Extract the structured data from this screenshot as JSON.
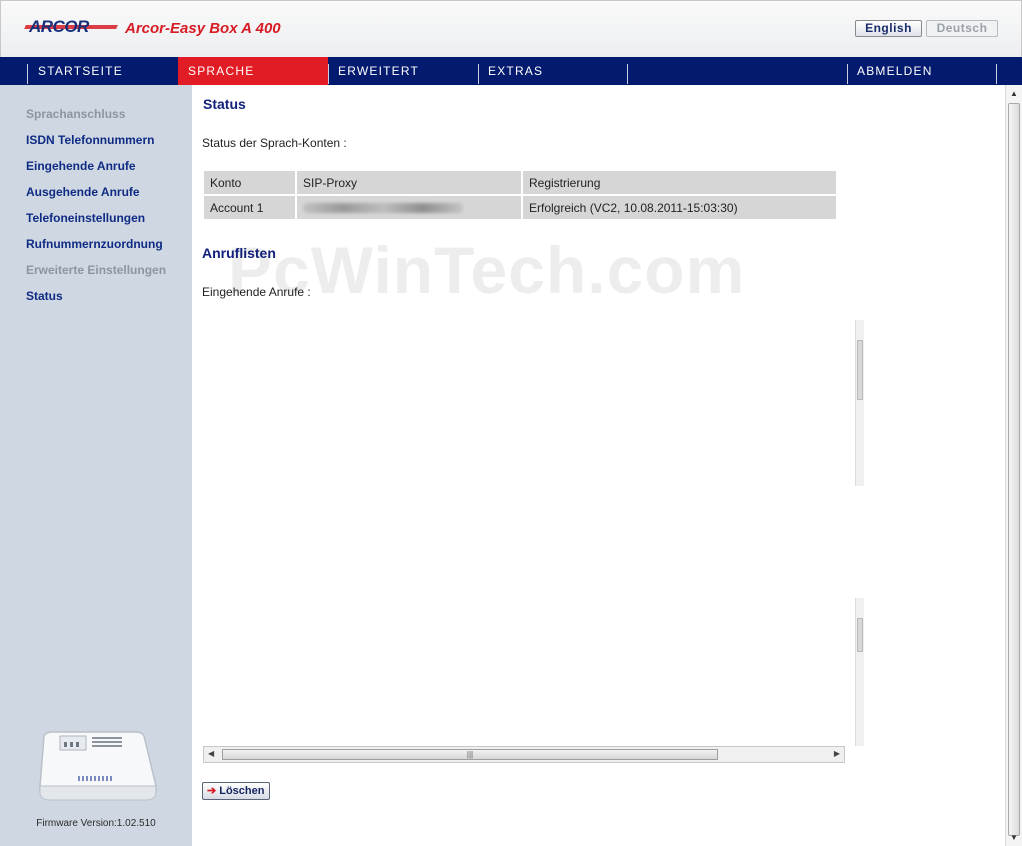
{
  "header": {
    "logo": "ARCOR",
    "product": "Arcor-Easy Box A 400",
    "lang_english": "English",
    "lang_deutsch": "Deutsch"
  },
  "nav": {
    "items": [
      "STARTSEITE",
      "SPRACHE",
      "ERWEITERT",
      "EXTRAS",
      "ABMELDEN"
    ],
    "active": "SPRACHE"
  },
  "sidebar": {
    "items": [
      {
        "label": "Sprachanschluss",
        "style": "muted"
      },
      {
        "label": "ISDN Telefonnummern",
        "style": "link"
      },
      {
        "label": "Eingehende Anrufe",
        "style": "link"
      },
      {
        "label": "Ausgehende Anrufe",
        "style": "link"
      },
      {
        "label": "Telefoneinstellungen",
        "style": "link"
      },
      {
        "label": "Rufnummernzuordnung",
        "style": "link"
      },
      {
        "label": "Erweiterte Einstellungen",
        "style": "muted"
      },
      {
        "label": "Status",
        "style": "link"
      }
    ],
    "firmware": "Firmware Version:1.02.510"
  },
  "main": {
    "status_title": "Status",
    "status_label": "Status der Sprach-Konten :",
    "table": {
      "headers": [
        "Konto",
        "SIP-Proxy",
        "Registrierung"
      ],
      "rows": [
        [
          "Account 1",
          "",
          "Erfolgreich (VC2, 10.08.2011-15:03:30)"
        ]
      ]
    },
    "anruf_title": "Anruflisten",
    "eingehende_label": "Eingehende Anrufe :",
    "delete_button": "Löschen",
    "watermark": "PcWinTech.com"
  },
  "colors": {
    "nav_bg": "#041a6e",
    "nav_active": "#e21c24",
    "sidebar_bg": "#cfd8e2",
    "link": "#0f2b84"
  }
}
